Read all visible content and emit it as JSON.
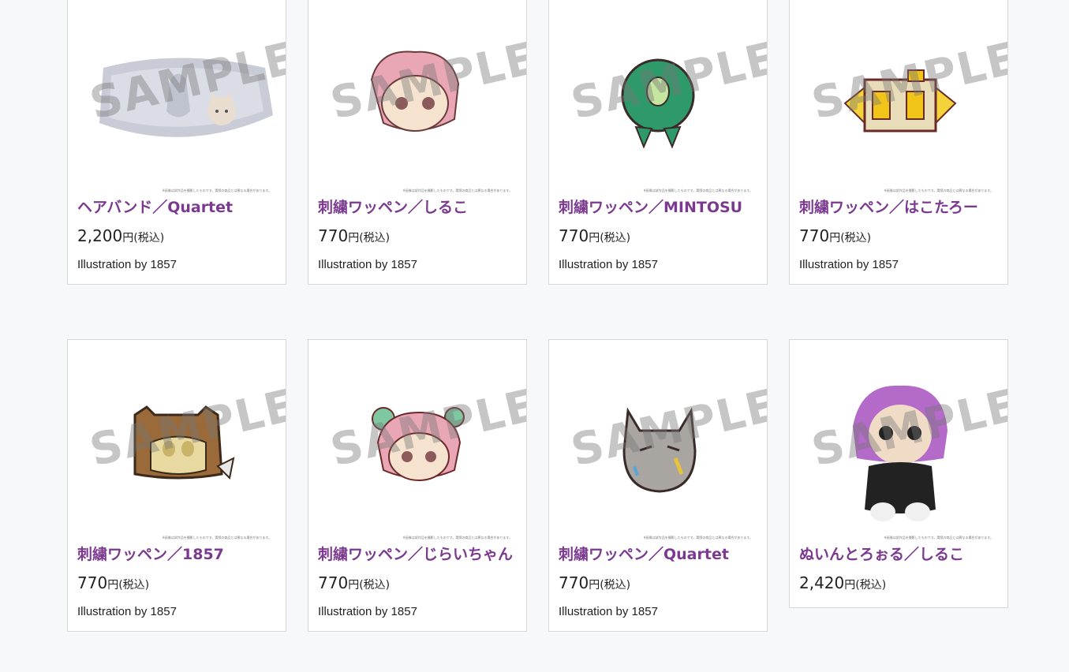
{
  "watermark_text": "SAMPLE",
  "disclaimer_text": "※画像は試作品を撮影したものです。実際の商品とは異なる場合があります。",
  "accent_color": "#7b3a8f",
  "products": [
    {
      "title": "ヘアバンド／Quartet",
      "price": "2,200",
      "yen": "円",
      "tax": "(税込)",
      "credit": "Illustration by 1857",
      "image": "headband"
    },
    {
      "title": "刺繍ワッペン／しるこ",
      "price": "770",
      "yen": "円",
      "tax": "(税込)",
      "credit": "Illustration by 1857",
      "image": "patch-shiruko"
    },
    {
      "title": "刺繍ワッペン／MINTOSU",
      "price": "770",
      "yen": "円",
      "tax": "(税込)",
      "credit": "Illustration by 1857",
      "image": "patch-mintosu"
    },
    {
      "title": "刺繍ワッペン／はこたろー",
      "price": "770",
      "yen": "円",
      "tax": "(税込)",
      "credit": "Illustration by 1857",
      "image": "patch-hakotaro"
    },
    {
      "title": "刺繍ワッペン／1857",
      "price": "770",
      "yen": "円",
      "tax": "(税込)",
      "credit": "Illustration by 1857",
      "image": "patch-1857"
    },
    {
      "title": "刺繍ワッペン／じらいちゃん",
      "price": "770",
      "yen": "円",
      "tax": "(税込)",
      "credit": "Illustration by 1857",
      "image": "patch-jiraichan"
    },
    {
      "title": "刺繍ワッペン／Quartet",
      "price": "770",
      "yen": "円",
      "tax": "(税込)",
      "credit": "Illustration by 1857",
      "image": "patch-quartet"
    },
    {
      "title": "ぬいんとろぉる／しるこ",
      "price": "2,420",
      "yen": "円",
      "tax": "(税込)",
      "credit": "",
      "image": "plush-shiruko"
    }
  ]
}
